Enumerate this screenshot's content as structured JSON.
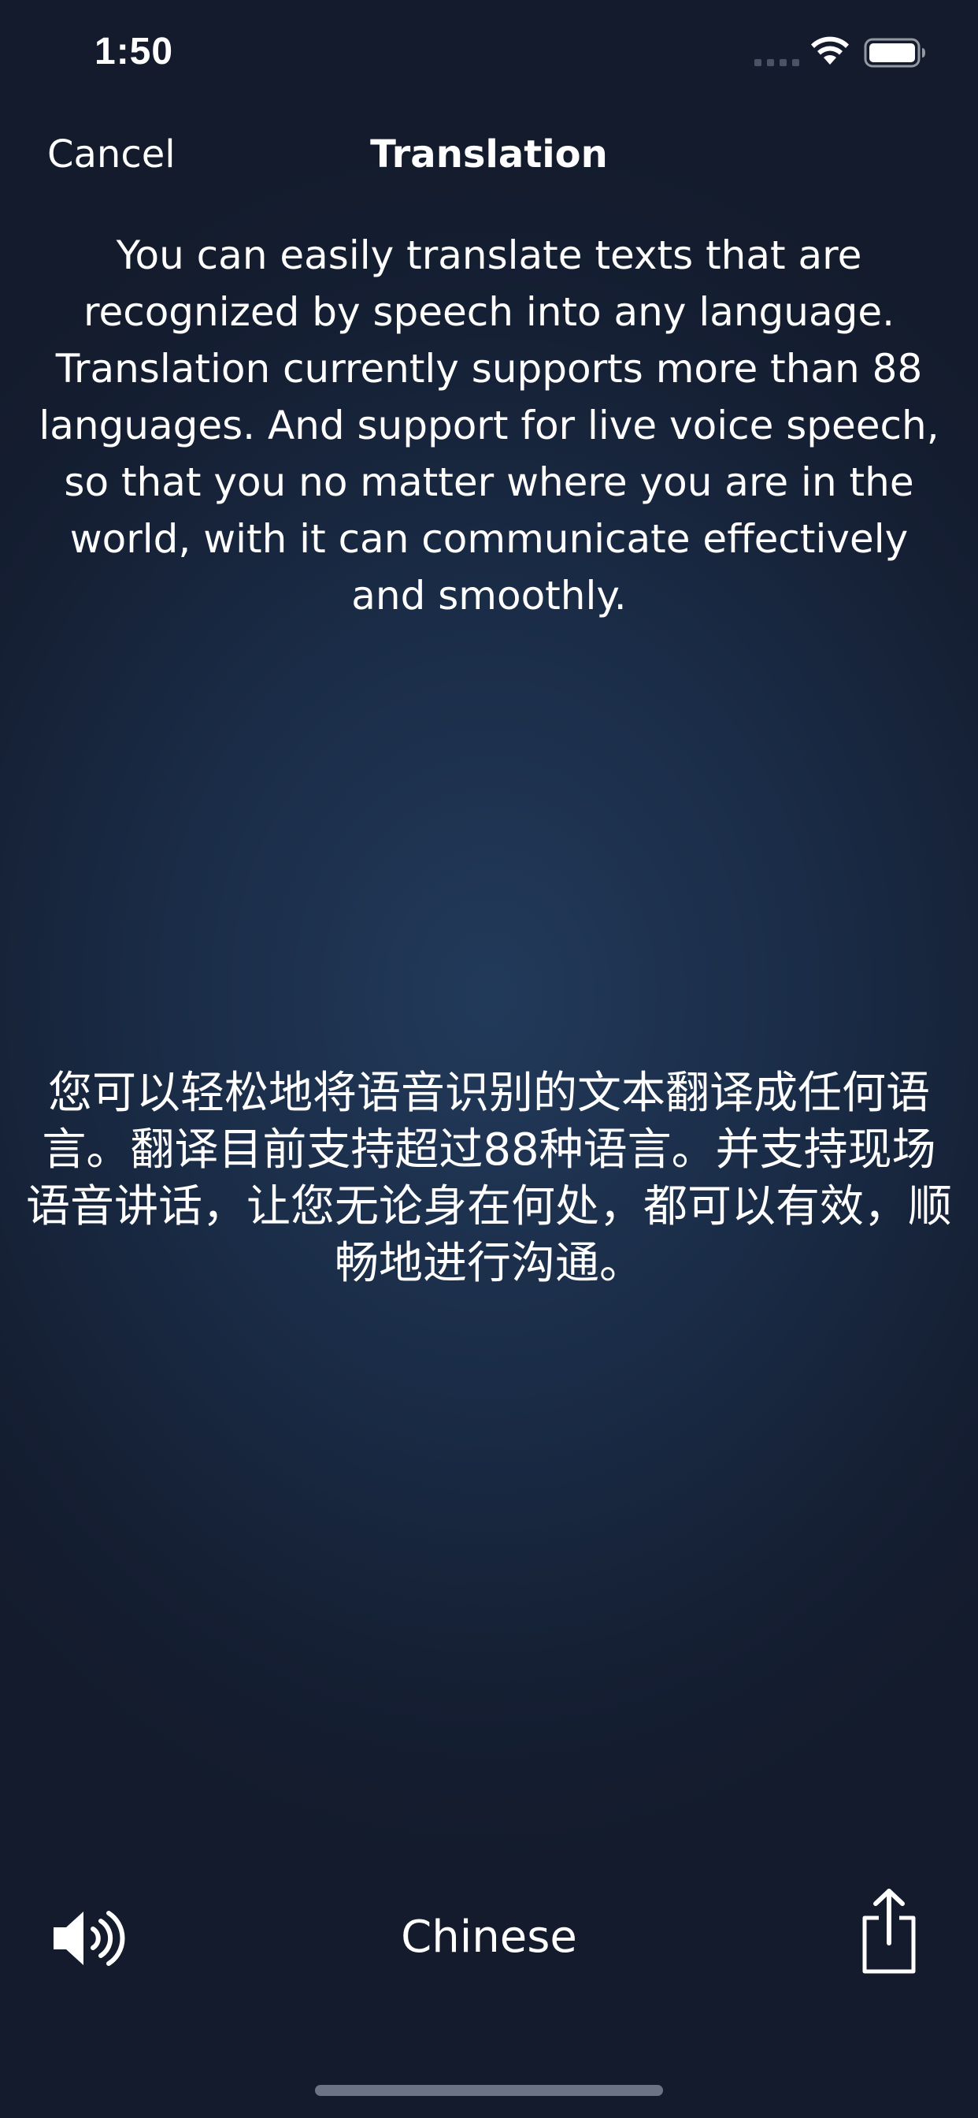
{
  "status_bar": {
    "time": "1:50"
  },
  "nav": {
    "cancel_label": "Cancel",
    "title": "Translation"
  },
  "source_text": "You can easily translate texts that are recognized by speech into any language. Translation currently supports more than 88 languages. And support for live voice speech, so that you no matter where you are in the world, with it can communicate effectively and smoothly.",
  "translated_text": "您可以轻松地将语音识别的文本翻译成任何语言。翻译目前支持超过88种语言。并支持现场语音讲话，让您无论身在何处，都可以有效，顺畅地进行沟通。",
  "bottom_bar": {
    "speaker_icon": "speaker-icon",
    "language_label": "Chinese",
    "share_icon": "share-icon"
  },
  "colors": {
    "background": "#1a2c47",
    "text": "#ffffff",
    "home_indicator": "#6b7485"
  }
}
